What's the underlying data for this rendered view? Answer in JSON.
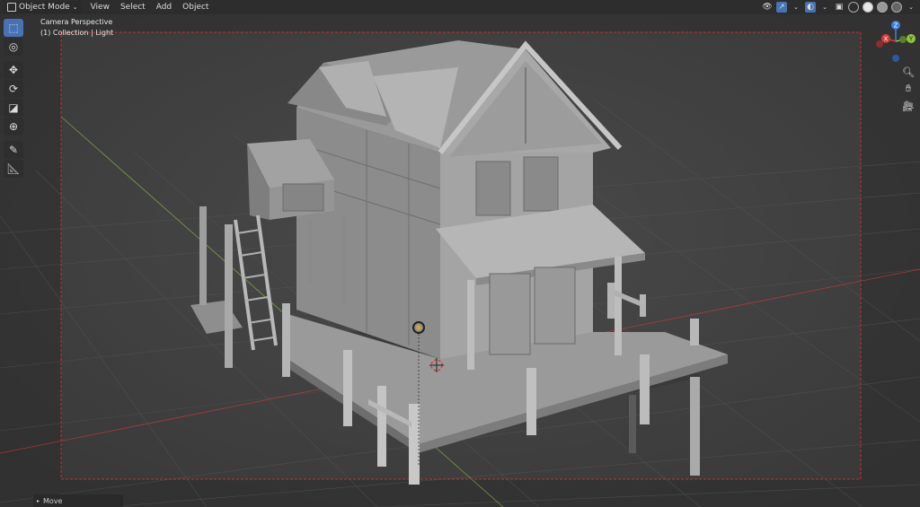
{
  "header": {
    "mode_label": "Object Mode",
    "menu": [
      "View",
      "Select",
      "Add",
      "Object"
    ]
  },
  "viewport": {
    "camera_label": "Camera Perspective",
    "collection_label": "(1) Collection | Light"
  },
  "gizmo": {
    "axes": [
      "Z",
      "Y",
      "X"
    ]
  },
  "toolbar": {
    "tools": [
      "select-box",
      "cursor",
      "move",
      "rotate",
      "scale",
      "transform",
      "annotate",
      "measure"
    ]
  },
  "status": {
    "last_op": "Move"
  },
  "colors": {
    "accent": "#4772b3",
    "x_axis": "#d63b3b",
    "y_axis": "#8cc63f",
    "z_axis": "#3f7fdd",
    "camera_frame": "#c03030"
  }
}
